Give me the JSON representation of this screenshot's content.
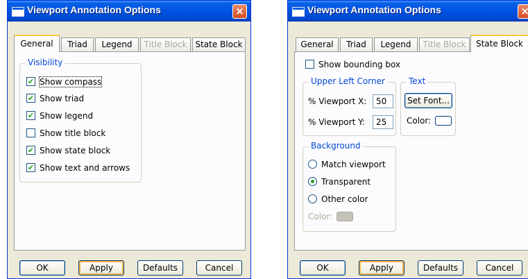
{
  "dialog_left": {
    "title": "Viewport Annotation Options",
    "close": "×",
    "tabs": [
      "General",
      "Triad",
      "Legend",
      "Title Block",
      "State Block"
    ],
    "active_tab": "General",
    "visibility": {
      "label": "Visibility",
      "items": [
        {
          "label": "Show compass",
          "checked": true
        },
        {
          "label": "Show triad",
          "checked": true
        },
        {
          "label": "Show legend",
          "checked": true
        },
        {
          "label": "Show title block",
          "checked": false
        },
        {
          "label": "Show state block",
          "checked": true
        },
        {
          "label": "Show text and arrows",
          "checked": true
        }
      ]
    },
    "buttons": {
      "ok": "OK",
      "apply": "Apply",
      "defaults": "Defaults",
      "cancel": "Cancel"
    }
  },
  "dialog_right": {
    "title": "Viewport Annotation Options",
    "close": "×",
    "tabs": [
      "General",
      "Triad",
      "Legend",
      "Title Block",
      "State Block"
    ],
    "active_tab": "State Block",
    "show_bounding_box": {
      "label": "Show bounding box",
      "checked": false
    },
    "upper_left": {
      "label": "Upper Left Corner",
      "x_label": "% Viewport X:",
      "x_value": "50",
      "y_label": "% Viewport Y:",
      "y_value": "25"
    },
    "text": {
      "label": "Text",
      "set_font": "Set Font...",
      "color_label": "Color:"
    },
    "background": {
      "label": "Background",
      "options": [
        {
          "label": "Match viewport",
          "selected": false
        },
        {
          "label": "Transparent",
          "selected": true
        },
        {
          "label": "Other color",
          "selected": false
        }
      ],
      "color_label": "Color:"
    },
    "buttons": {
      "ok": "OK",
      "apply": "Apply",
      "defaults": "Defaults",
      "cancel": "Cancel"
    }
  },
  "colors": {
    "titlebar": "#0054e3",
    "group_label": "#0046d5",
    "active_tab_accent": "#ffc83c",
    "check": "#21a121"
  }
}
